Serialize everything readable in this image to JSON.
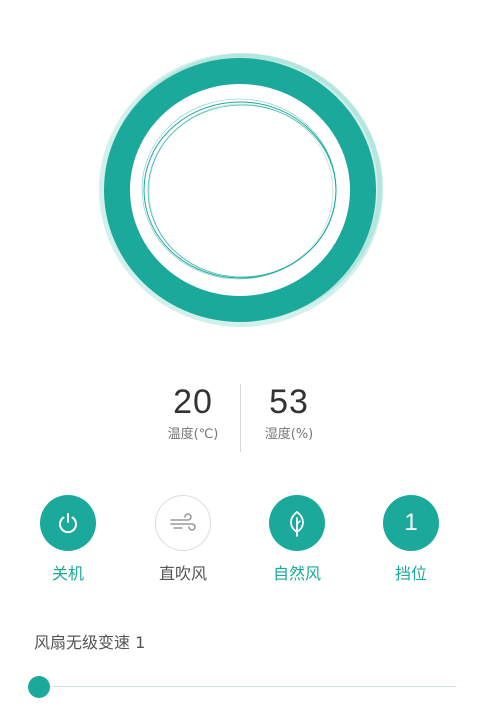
{
  "readings": {
    "temperature": {
      "value": "20",
      "label": "温度(℃)"
    },
    "humidity": {
      "value": "53",
      "label": "湿度(%)"
    }
  },
  "controls": [
    {
      "label": "关机",
      "icon": "power-icon",
      "active": true
    },
    {
      "label": "直吹风",
      "icon": "wind-icon",
      "active": false
    },
    {
      "label": "自然风",
      "icon": "leaf-icon",
      "active": true
    },
    {
      "label": "挡位",
      "icon": "gear-level",
      "value": "1",
      "active": true
    }
  ],
  "speed": {
    "label": "风扇无级变速 1",
    "level": 0.0
  },
  "colors": {
    "accent": "#1aa99b",
    "accent_light": "#7fd3c9",
    "text": "#333333",
    "muted": "#777777"
  }
}
